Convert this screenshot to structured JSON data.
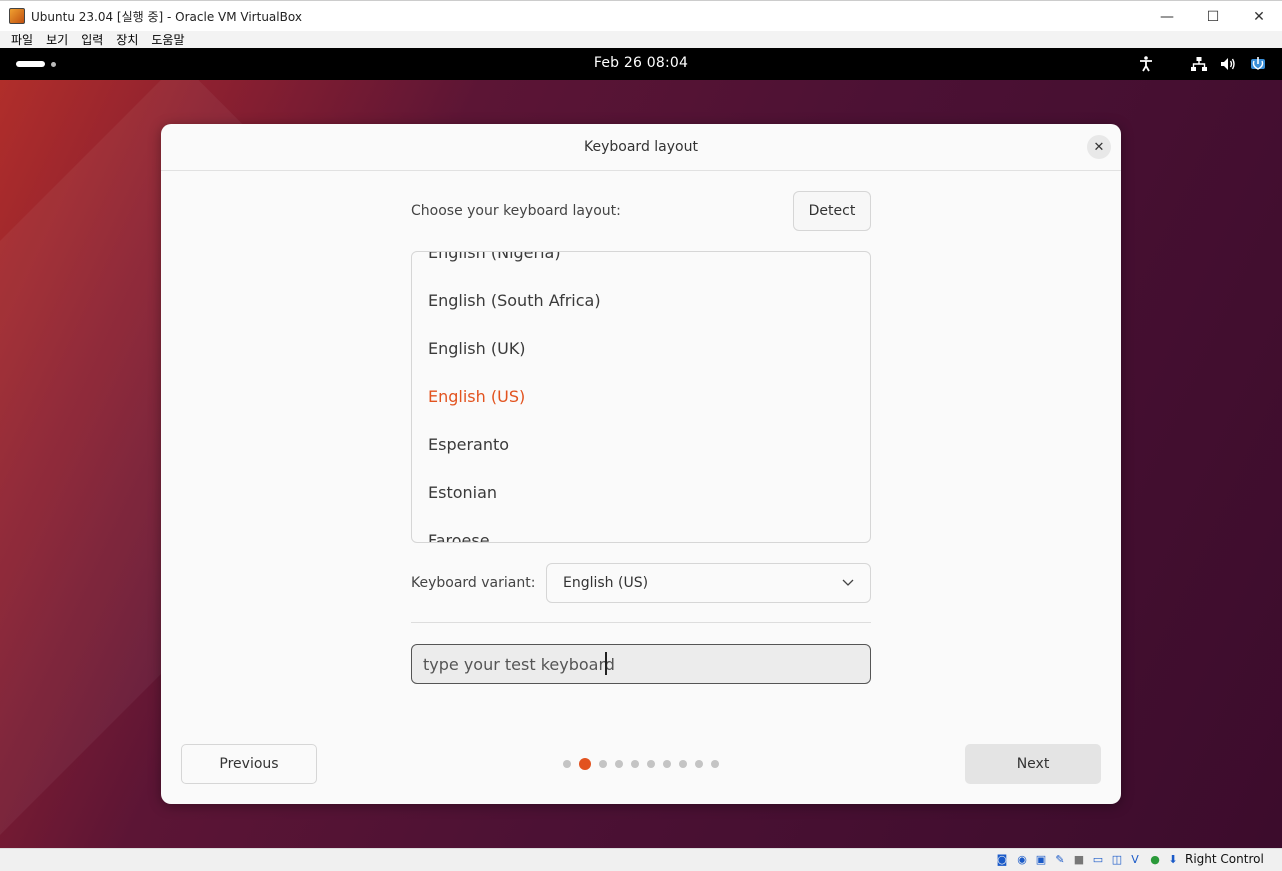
{
  "window": {
    "title": "Ubuntu 23.04 [실행 중] - Oracle VM VirtualBox",
    "minimize": "—",
    "maximize": "☐",
    "close": "✕"
  },
  "menubar": {
    "items": [
      "파일",
      "보기",
      "입력",
      "장치",
      "도움말"
    ]
  },
  "gnome_topbar": {
    "clock": "Feb 26  08:04",
    "tray_icons": [
      "accessibility-icon",
      "network-icon",
      "volume-icon",
      "power-icon"
    ]
  },
  "dialog": {
    "title": "Keyboard layout",
    "close": "✕",
    "layout_label": "Choose your keyboard layout:",
    "detect_label": "Detect",
    "layouts": [
      "English (Nigeria)",
      "English (South Africa)",
      "English (UK)",
      "English (US)",
      "Esperanto",
      "Estonian",
      "Faroese"
    ],
    "selected_layout": "English (US)",
    "variant_label": "Keyboard variant:",
    "variant_value": "English (US)",
    "test_placeholder": "type your test keyboard",
    "previous_label": "Previous",
    "next_label": "Next",
    "steps_total": 10,
    "current_step": 2
  },
  "statusbar": {
    "host_key": "Right Control"
  },
  "colors": {
    "accent": "#e2531f",
    "topbar": "#000000",
    "dialog_bg": "#fafafa"
  }
}
